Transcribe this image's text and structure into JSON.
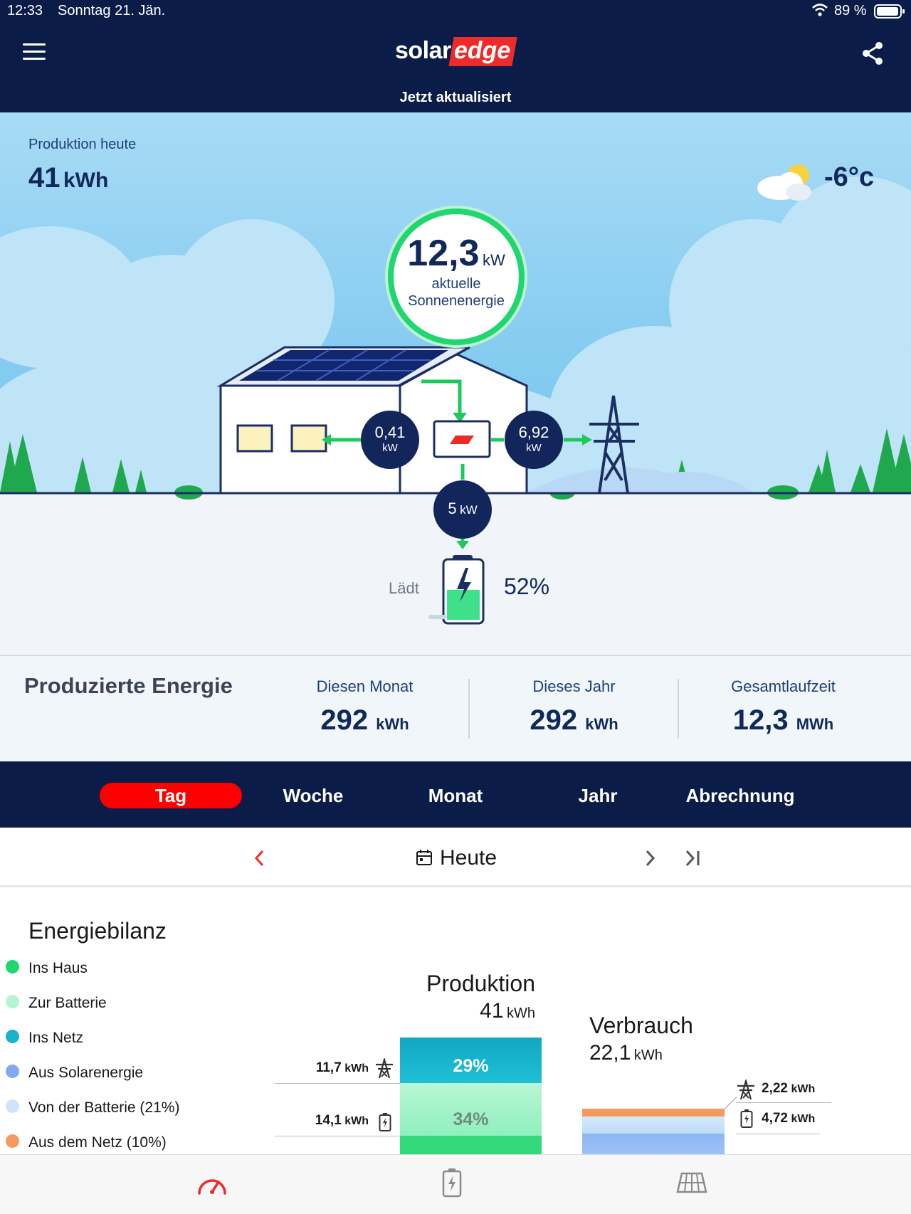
{
  "status_bar": {
    "time": "12:33",
    "date": "Sonntag 21. Jän.",
    "battery_pct": "89 %"
  },
  "header": {
    "logo_part1": "solar",
    "logo_part2": "edge",
    "updated": "Jetzt aktualisiert"
  },
  "production_today": {
    "label": "Produktion heute",
    "value": "41",
    "unit": "kWh"
  },
  "weather": {
    "temperature": "-6°c",
    "icon": "partly-cloudy-icon"
  },
  "flow": {
    "solar_value": "12,3",
    "solar_unit": "kW",
    "solar_label_1": "aktuelle",
    "solar_label_2": "Sonnenenergie",
    "house_value": "0,41",
    "house_unit": "kW",
    "grid_value": "6,92",
    "grid_unit": "kW",
    "battery_value": "5",
    "battery_unit": "kW",
    "battery_status": "Lädt",
    "battery_pct": "52%",
    "battery_level": 0.52
  },
  "produced_energy": {
    "title": "Produzierte Energie",
    "stats": [
      {
        "label": "Diesen Monat",
        "value": "292",
        "unit": "kWh"
      },
      {
        "label": "Dieses Jahr",
        "value": "292",
        "unit": "kWh"
      },
      {
        "label": "Gesamtlaufzeit",
        "value": "12,3",
        "unit": "MWh"
      }
    ]
  },
  "tabs": [
    "Tag",
    "Woche",
    "Monat",
    "Jahr",
    "Abrechnung"
  ],
  "active_tab": "Tag",
  "date_nav": {
    "label": "Heute"
  },
  "energy_balance": {
    "title": "Energiebilanz",
    "legend": [
      {
        "label": "Ins Haus",
        "color": "#1fd66f"
      },
      {
        "label": "Zur Batterie",
        "color": "#b6f5d3"
      },
      {
        "label": "Ins Netz",
        "color": "#17b3cc"
      },
      {
        "label": "Aus Solarenergie",
        "color": "#7faaf1"
      },
      {
        "label": "Von der Batterie (21%)",
        "color": "#cfe4fb"
      },
      {
        "label": "Aus dem Netz (10%)",
        "color": "#f59a5e"
      }
    ],
    "production": {
      "title": "Produktion",
      "value": "41",
      "unit": "kWh",
      "grid_value": "11,7",
      "grid_unit": "kWh",
      "grid_pct": "29%",
      "battery_value": "14,1",
      "battery_unit": "kWh",
      "battery_pct": "34%"
    },
    "consumption": {
      "title": "Verbrauch",
      "value": "22,1",
      "unit": "kWh",
      "grid_value": "2,22",
      "grid_unit": "kWh",
      "battery_value": "4,72",
      "battery_unit": "kWh"
    }
  },
  "colors": {
    "navy": "#0c1c49",
    "accent_red": "#ff0000",
    "flow_green": "#1ec95b"
  }
}
